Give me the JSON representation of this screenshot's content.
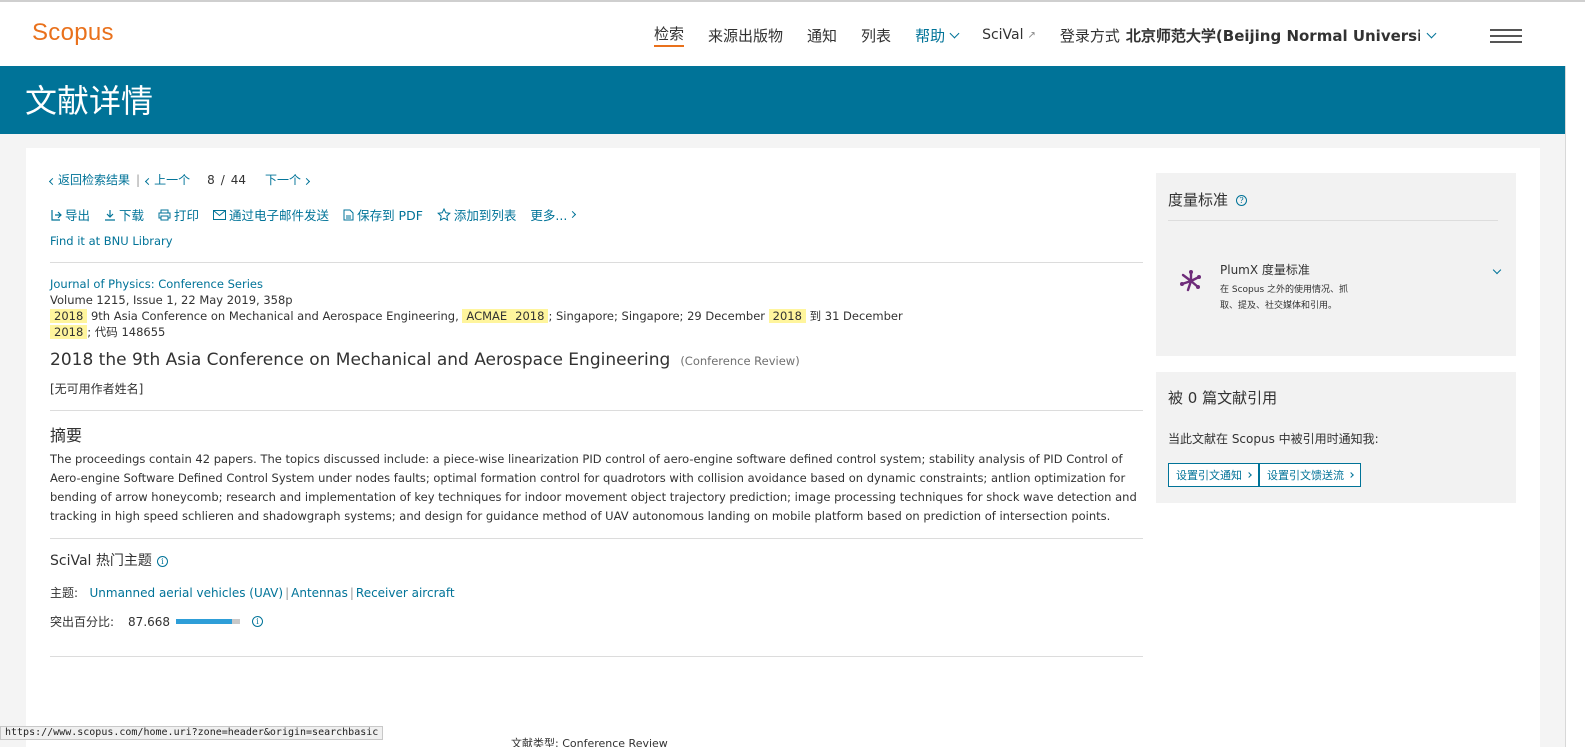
{
  "header": {
    "logo": "Scopus",
    "nav": [
      "检索",
      "来源出版物",
      "通知",
      "列表"
    ],
    "help": "帮助",
    "scival": "SciVal",
    "login_label": "登录方式",
    "institution": "北京师范大学(Beijing Normal Universi"
  },
  "page_title": "文献详情",
  "pager": {
    "back": "返回检索结果",
    "prev": "上一个",
    "current": "8",
    "separator": "/",
    "total": "44",
    "next": "下一个"
  },
  "actions": {
    "export": "导出",
    "download": "下载",
    "print": "打印",
    "email": "通过电子邮件发送",
    "save_pdf": "保存到 PDF",
    "add_list": "添加到列表",
    "more": "更多..."
  },
  "library_link": "Find it at BNU Library",
  "source": {
    "journal": "Journal of Physics: Conference Series",
    "volume": "Volume 1215, Issue 1, 22 May 2019, 358p",
    "hl_year": "2018",
    "conf_name": "9th Asia Conference on Mechanical and Aerospace Engineering,",
    "hl_acronym": "ACMAE",
    "location": "; Singapore; Singapore; 29 December",
    "to": "到 31 December",
    "code": "; 代码 148655"
  },
  "document": {
    "title": "2018 the 9th Asia Conference on Mechanical and Aerospace Engineering",
    "type": "(Conference Review)",
    "authors": "[无可用作者姓名]"
  },
  "abstract": {
    "heading": "摘要",
    "text": "The proceedings contain 42 papers. The topics discussed include: a piece-wise linearization PID control of aero-engine software defined control system; stability analysis of PID Control of Aero-engine Software Defined Control System under nodes faults; optimal formation control for quadrotors with collision avoidance based on dynamic constraints; antlion optimization for bending of arrow honeycomb; research and implementation of key techniques for indoor movement object trajectory prediction; image processing techniques for shock wave detection and tracking in high speed schlieren and shadowgraph systems; and design for guidance method of UAV autonomous landing on mobile platform based on prediction of intersection points."
  },
  "scival": {
    "heading": "SciVal 热门主题",
    "topic_label": "主题:",
    "topics": [
      "Unmanned aerial vehicles (UAV)",
      "Antennas",
      "Receiver aircraft"
    ],
    "pct_label": "突出百分比:",
    "pct_value": "87.668",
    "pct_fraction": 0.877
  },
  "metrics": {
    "heading": "度量标准",
    "plumx_title": "PlumX 度量标准",
    "plumx_desc": "在 Scopus 之外的使用情况、抓取、提及、社交媒体和引用。"
  },
  "citations": {
    "heading": "被 0 篇文献引用",
    "note": "当此文献在 Scopus 中被引用时通知我:",
    "btn_alert": "设置引文通知",
    "btn_feed": "设置引文馈送流"
  },
  "status_url": "https://www.scopus.com/home.uri?zone=header&origin=searchbasic",
  "partial_text": "文献类型: Conference Review",
  "colors": {
    "brand_orange": "#e9711c",
    "brand_blue": "#007398",
    "highlight": "#fff59d",
    "plumx_purple": "#6e2c7a"
  }
}
